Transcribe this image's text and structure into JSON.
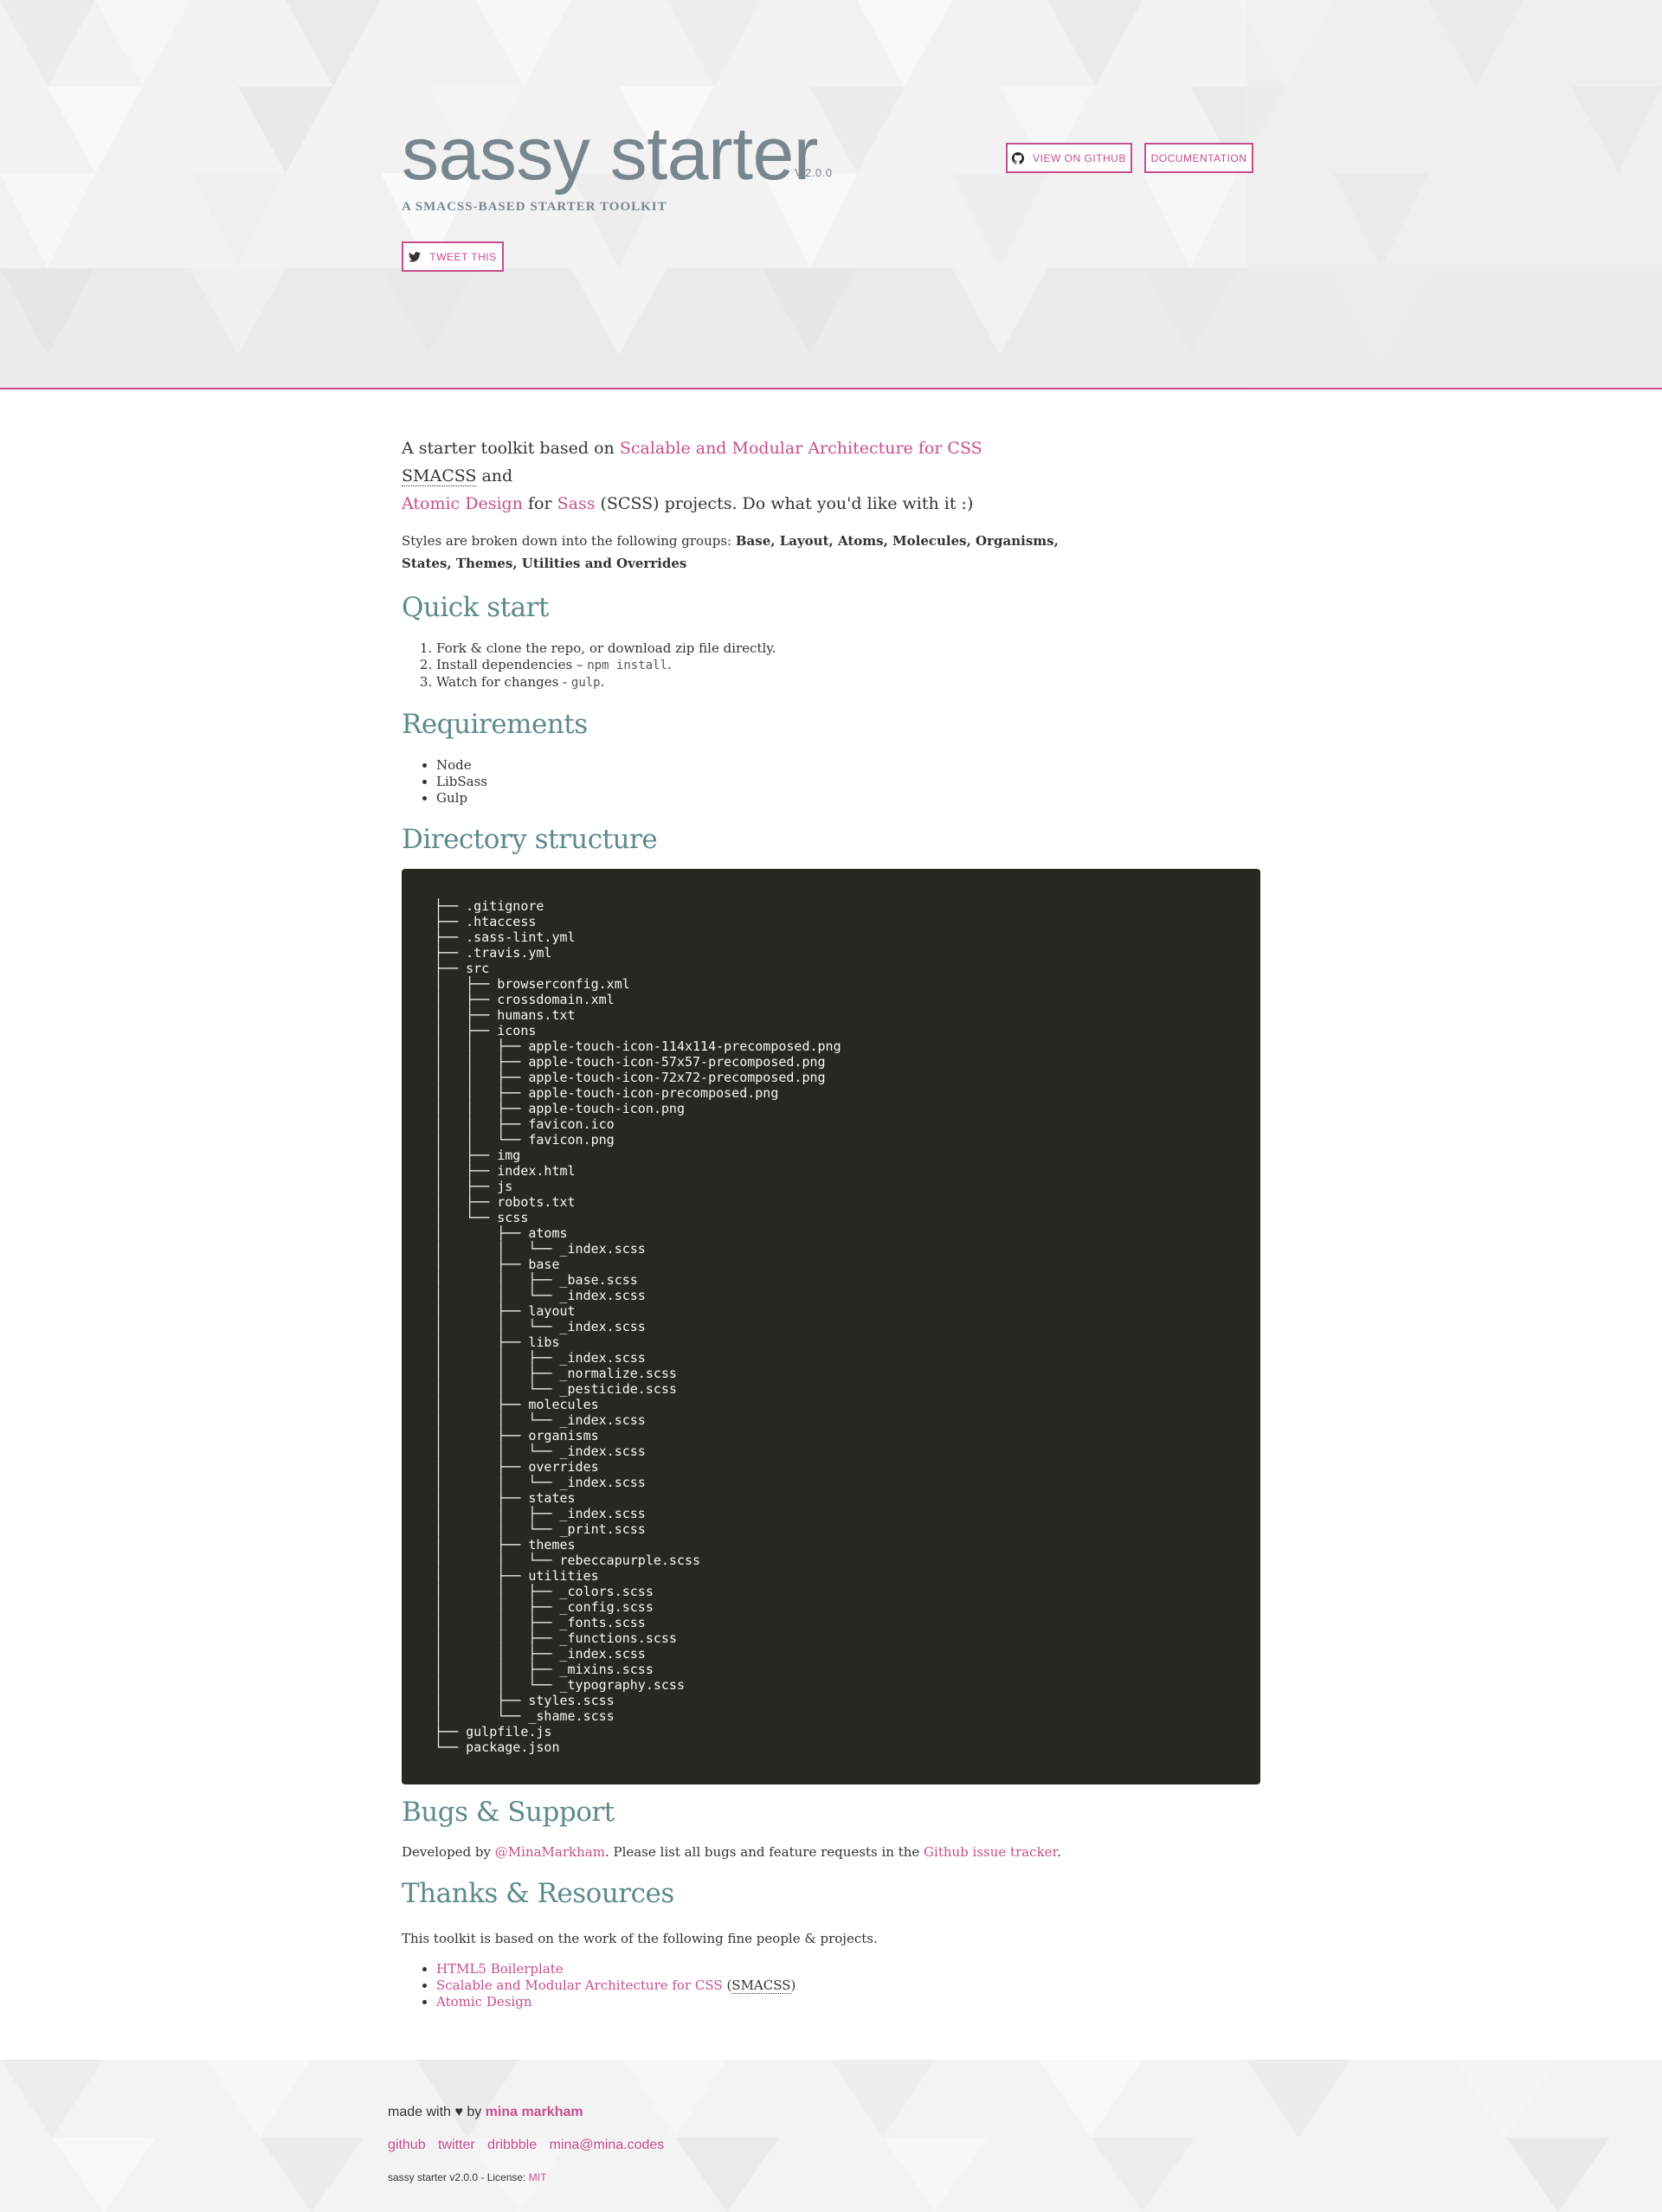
{
  "header": {
    "title": "sassy starter",
    "version": "V.2.0.0",
    "tagline": "A SMACSS-BASED STARTER TOOLKIT",
    "github_button": "VIEW ON GITHUB",
    "docs_button": "DOCUMENTATION",
    "tweet_button": "TWEET THIS"
  },
  "intro": {
    "p1_before": "A starter toolkit based on ",
    "smacss_link": "Scalable and Modular Architecture for CSS",
    "smacss_abbr": "SMACSS",
    "p1_and": " and",
    "atomic_link": "Atomic Design",
    "p1_for": " for ",
    "sass_link": "Sass",
    "p1_after": " (SCSS) projects. Do what you'd like with it :)",
    "groups_before": "Styles are broken down into the following groups: ",
    "groups_bold": "Base, Layout, Atoms, Molecules, Organisms, States, Themes, Utilities and Overrides"
  },
  "quick_start": {
    "heading": "Quick start",
    "step1": "Fork & clone the repo, or download zip file directly.",
    "step2_text": "Install dependencies – ",
    "step2_code": "npm install",
    "step2_end": ".",
    "step3_text": "Watch for changes - ",
    "step3_code": "gulp",
    "step3_end": "."
  },
  "requirements": {
    "heading": "Requirements",
    "items": [
      "Node",
      "LibSass",
      "Gulp"
    ]
  },
  "directory": {
    "heading": "Directory structure",
    "lines": [
      "├── .gitignore",
      "├── .htaccess",
      "├── .sass-lint.yml",
      "├── .travis.yml",
      "├── src",
      "│   ├── browserconfig.xml",
      "│   ├── crossdomain.xml",
      "│   ├── humans.txt",
      "│   ├── icons",
      "│   │   ├── apple-touch-icon-114x114-precomposed.png",
      "│   │   ├── apple-touch-icon-57x57-precomposed.png",
      "│   │   ├── apple-touch-icon-72x72-precomposed.png",
      "│   │   ├── apple-touch-icon-precomposed.png",
      "│   │   ├── apple-touch-icon.png",
      "│   │   ├── favicon.ico",
      "│   │   └── favicon.png",
      "│   ├── img",
      "│   ├── index.html",
      "│   ├── js",
      "│   ├── robots.txt",
      "│   └── scss",
      "│       ├── atoms",
      "│       │   └── _index.scss",
      "│       ├── base",
      "│       │   ├── _base.scss",
      "│       │   └── _index.scss",
      "│       ├── layout",
      "│       │   └── _index.scss",
      "│       ├── libs",
      "│       │   ├── _index.scss",
      "│       │   ├── _normalize.scss",
      "│       │   └── _pesticide.scss",
      "│       ├── molecules",
      "│       │   └── _index.scss",
      "│       ├── organisms",
      "│       │   └── _index.scss",
      "│       ├── overrides",
      "│       │   └── _index.scss",
      "│       ├── states",
      "│       │   ├── _index.scss",
      "│       │   └── _print.scss",
      "│       ├── themes",
      "│       │   └── rebeccapurple.scss",
      "│       ├── utilities",
      "│       │   ├── _colors.scss",
      "│       │   ├── _config.scss",
      "│       │   ├── _fonts.scss",
      "│       │   ├── _functions.scss",
      "│       │   ├── _index.scss",
      "│       │   ├── _mixins.scss",
      "│       │   └── _typography.scss",
      "│       ├── styles.scss",
      "│       └── _shame.scss",
      "├── gulpfile.js",
      "└── package.json"
    ]
  },
  "bugs": {
    "heading": "Bugs & Support",
    "before": "Developed by ",
    "author_link": "@MinaMarkham",
    "middle": ". Please list all bugs and feature requests in the ",
    "tracker_link": "Github issue tracker",
    "end": "."
  },
  "thanks": {
    "heading": "Thanks & Resources",
    "intro": "This toolkit is based on the work of the following fine people & projects.",
    "link1": "HTML5 Boilerplate",
    "link2": "Scalable and Modular Architecture for CSS",
    "link2_abbr_open": " (",
    "link2_abbr": "SMACSS",
    "link2_abbr_close": ")",
    "link3": "Atomic Design"
  },
  "footer": {
    "made_with": "made with ♥ by ",
    "author": "mina markham",
    "links": [
      "github",
      "twitter",
      "dribbble",
      "mina@mina.codes"
    ],
    "license_text": "sassy starter v2.0.0 - License: ",
    "license_link": "MIT"
  },
  "colors": {
    "accent": "#c64f8b",
    "heading": "#5d8a8c",
    "title_gray": "#78868d",
    "code_bg": "#272822"
  }
}
